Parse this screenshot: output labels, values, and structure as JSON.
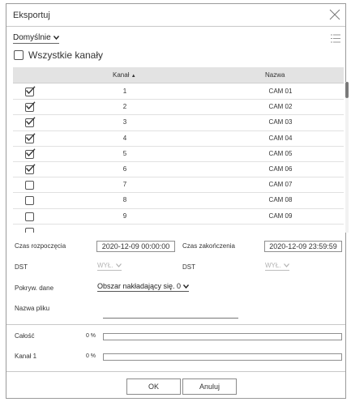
{
  "dialog": {
    "title": "Eksportuj"
  },
  "preset": {
    "value": "Domyślnie"
  },
  "all_channels": {
    "label": "Wszystkie kanały",
    "checked": false
  },
  "table": {
    "headers": {
      "channel": "Kanał",
      "sort_indicator": "▲",
      "name": "Nazwa"
    },
    "rows": [
      {
        "num": "1",
        "name": "CAM 01",
        "checked": true
      },
      {
        "num": "2",
        "name": "CAM 02",
        "checked": true
      },
      {
        "num": "3",
        "name": "CAM 03",
        "checked": true
      },
      {
        "num": "4",
        "name": "CAM 04",
        "checked": true
      },
      {
        "num": "5",
        "name": "CAM 05",
        "checked": true
      },
      {
        "num": "6",
        "name": "CAM 06",
        "checked": true
      },
      {
        "num": "7",
        "name": "CAM 07",
        "checked": false
      },
      {
        "num": "8",
        "name": "CAM 08",
        "checked": false
      },
      {
        "num": "9",
        "name": "CAM 09",
        "checked": false
      },
      {
        "num": "",
        "name": "",
        "checked": false
      }
    ]
  },
  "form": {
    "start_label": "Czas rozpoczęcia",
    "start_value": "2020-12-09 00:00:00",
    "end_label": "Czas zakończenia",
    "end_value": "2020-12-09 23:59:59",
    "dst_label_1": "DST",
    "dst_value_1": "WYŁ.",
    "dst_label_2": "DST",
    "dst_value_2": "WYŁ.",
    "overlap_label": "Pokryw. dane",
    "overlap_value": "Obszar nakładający się. 0",
    "filename_label": "Nazwa pliku",
    "filename_value": ""
  },
  "progress": {
    "total_label": "Całość",
    "total_pct": "0 %",
    "total_fraction": 0,
    "channel_label": "Kanał 1",
    "channel_pct": "0 %",
    "channel_fraction": 0
  },
  "buttons": {
    "ok": "OK",
    "cancel": "Anuluj"
  },
  "colors": {
    "progress_fill": "#4a7fc4",
    "header_bg": "#e3e3e3"
  }
}
